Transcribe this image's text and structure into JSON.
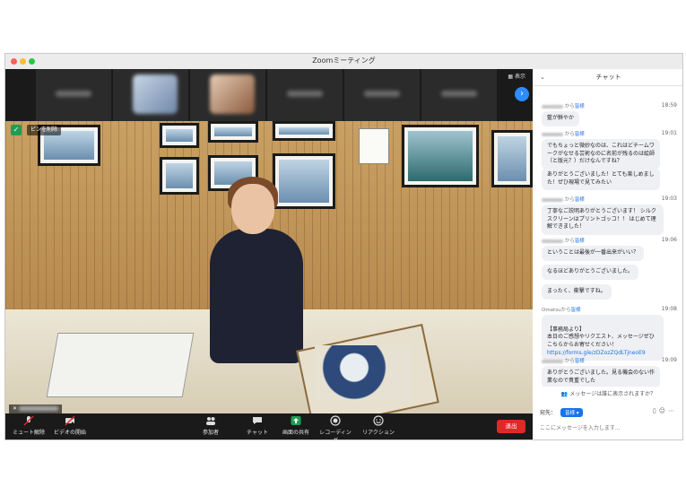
{
  "window": {
    "title": "Zoomミーティング"
  },
  "colors": {
    "accent": "#2d8cff",
    "end": "#e02828",
    "share": "#1f9d55",
    "link": "#1a73e8"
  },
  "video": {
    "view_label": "表示",
    "pin_label": "ピンを削除",
    "speaker_name": "",
    "thumbnails": [
      "",
      "",
      "",
      "",
      "",
      "",
      ""
    ]
  },
  "toolbar": {
    "mute": "ミュート解除",
    "video": "ビデオの開始",
    "participants": "参加者",
    "participants_count": "",
    "chat": "チャット",
    "share": "画面の共有",
    "record": "レコーディング",
    "reactions": "リアクション",
    "end": "退出"
  },
  "chat": {
    "title": "チャット",
    "messages": [
      {
        "from": "から",
        "to": "皆様",
        "time": "18:59",
        "text": "藍が鮮やか"
      },
      {
        "from": "から",
        "to": "皆様",
        "time": "19:01",
        "text": "でもちょっと微妙なのは、これはどチームワークがなせる芸術なのに名前が残るのは絵師（と版元？）だけなんですね？"
      },
      {
        "text": "ありがとうございました！とても楽しめました！ぜひ現場で見てみたい"
      },
      {
        "from": "から",
        "to": "皆様",
        "time": "19:03",
        "text": "丁寧なご説明ありがとうございます！ シルクスクリーンはプリントゴッコ！！ はじめて理解できました！"
      },
      {
        "from": "から",
        "to": "皆様",
        "time": "19:06",
        "text": "ということは最後が一番出来がいい？"
      },
      {
        "text": "なるほどありがとうございました。"
      },
      {
        "text": "まったく、衝撃ですね。"
      },
      {
        "from": "Omatsuから",
        "to": "皆様",
        "time": "19:08",
        "text": "【事務局より】\n本日のご感想やリクエスト、メッセージぜひこちらからお寄せください！",
        "link": "https://forms.gle/zDZozZQdLTjneoE9"
      },
      {
        "from": "から",
        "to": "皆様",
        "time": "19:09",
        "text": "ありがとうございました。見る機会のない作業なので貴重でした"
      }
    ],
    "visibility_notice": "メッセージは誰に表示されますか？",
    "recipient_label": "宛先：",
    "recipient_value": "皆様",
    "input_placeholder": "ここにメッセージを入力します..."
  }
}
